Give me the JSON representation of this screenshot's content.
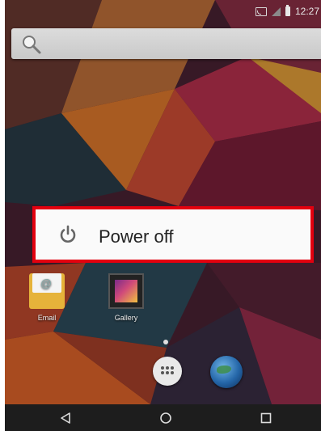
{
  "status_bar": {
    "time": "12:27",
    "icons": [
      "cast-icon",
      "signal-icon",
      "battery-icon"
    ]
  },
  "search_bar": {
    "icon": "search-icon"
  },
  "power_dialog": {
    "label": "Power off",
    "icon": "power-icon",
    "highlight_color": "#e3000f"
  },
  "apps": [
    {
      "label": "Email",
      "icon": "email-icon"
    },
    {
      "label": "Gallery",
      "icon": "gallery-icon"
    }
  ],
  "dock": {
    "page_indicator": "dot",
    "items": [
      "app-drawer-icon",
      "browser-globe-icon"
    ]
  },
  "nav_bar": {
    "buttons": [
      "back-icon",
      "home-icon",
      "recents-icon"
    ]
  }
}
